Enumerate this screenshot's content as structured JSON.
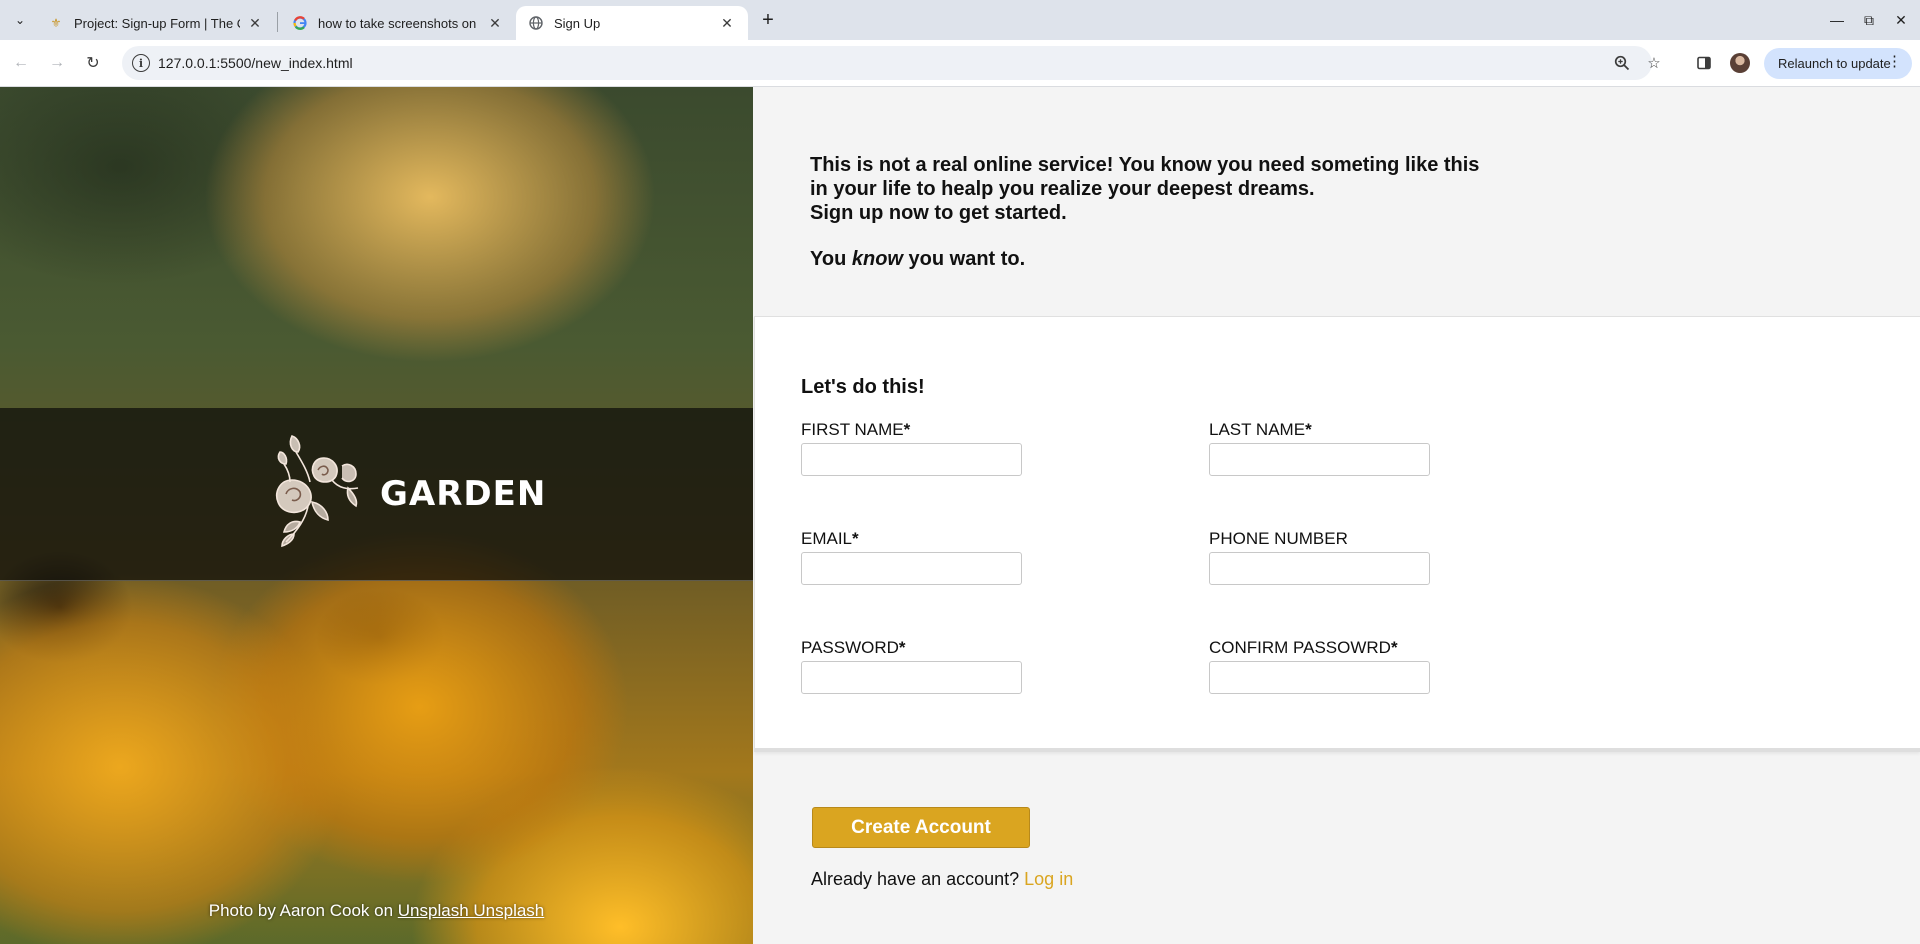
{
  "browser": {
    "tabs": [
      {
        "title": "Project: Sign-up Form | The O",
        "icon": "odin-icon"
      },
      {
        "title": "how to take screenshots on li",
        "icon": "google-icon"
      },
      {
        "title": "Sign Up",
        "icon": "globe-icon",
        "active": true
      }
    ],
    "url": "127.0.0.1:5500/new_index.html",
    "relaunch_label": "Relaunch to update"
  },
  "sidebar": {
    "logo_text": "GARDEN",
    "credit_prefix": "Photo by Aaron Cook on ",
    "credit_link": "Unsplash Unsplash"
  },
  "intro": {
    "line1": "This is not a real online service! You know you need someting like this",
    "line2": "in your life to healp you realize your deepest dreams.",
    "line3": "Sign up now to get started.",
    "know_before": "You ",
    "know_em": "know",
    "know_after": " you want to."
  },
  "form": {
    "heading": "Let's do this!",
    "fields": {
      "first_name": {
        "label": "FIRST NAME",
        "required": "*",
        "value": ""
      },
      "last_name": {
        "label": "LAST NAME",
        "required": "*",
        "value": ""
      },
      "email": {
        "label": "EMAIL",
        "required": "*",
        "value": ""
      },
      "phone": {
        "label": "PHONE NUMBER",
        "value": ""
      },
      "password": {
        "label": "PASSWORD",
        "required": "*",
        "value": ""
      },
      "confirm_password": {
        "label": "CONFIRM PASSOWRD",
        "required": "*",
        "value": ""
      }
    }
  },
  "footer": {
    "create_label": "Create Account",
    "login_prompt": "Already have an account? ",
    "login_link": "Log in"
  },
  "colors": {
    "accent": "#daa520",
    "chrome_tabstrip": "#dee3eb",
    "relaunch_bg": "#d3e3fd"
  }
}
